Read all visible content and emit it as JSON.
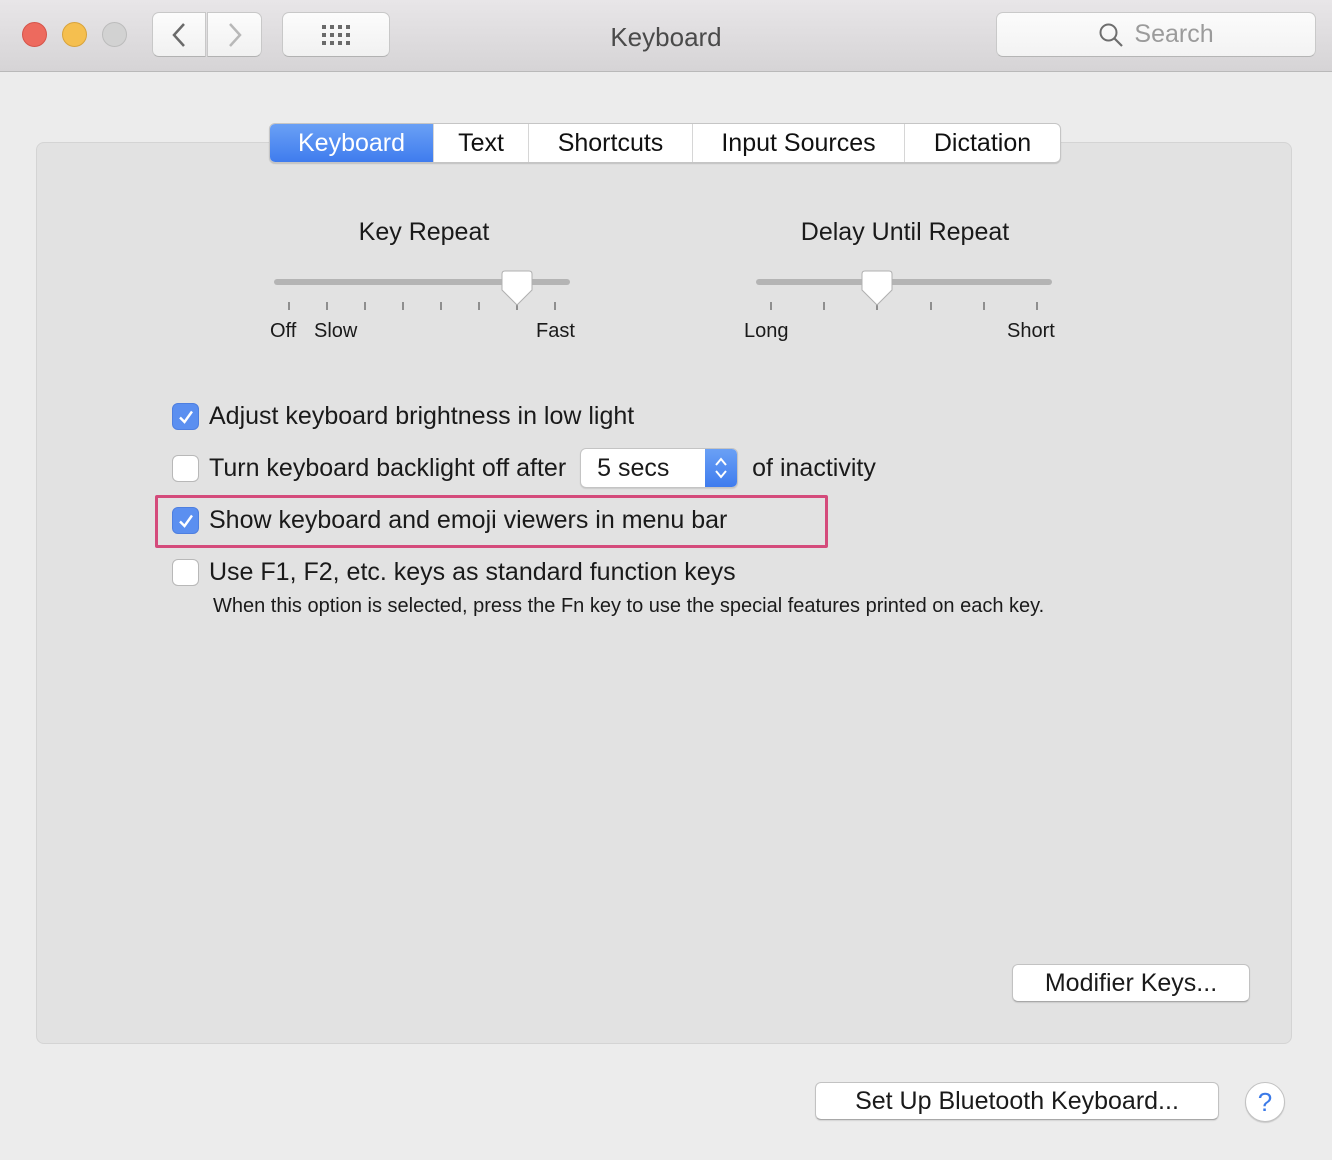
{
  "window": {
    "title": "Keyboard",
    "search_placeholder": "Search"
  },
  "tabs": [
    {
      "label": "Keyboard",
      "active": true
    },
    {
      "label": "Text",
      "active": false
    },
    {
      "label": "Shortcuts",
      "active": false
    },
    {
      "label": "Input Sources",
      "active": false
    },
    {
      "label": "Dictation",
      "active": false
    }
  ],
  "sliders": {
    "key_repeat": {
      "title": "Key Repeat",
      "labels": {
        "off": "Off",
        "slow": "Slow",
        "fast": "Fast"
      },
      "tick_count": 8,
      "selected_tick": 6
    },
    "delay_until_repeat": {
      "title": "Delay Until Repeat",
      "labels": {
        "long": "Long",
        "short": "Short"
      },
      "tick_count": 6,
      "selected_tick": 2
    }
  },
  "options": {
    "adjust_brightness": {
      "label": "Adjust keyboard brightness in low light",
      "checked": true
    },
    "backlight_off": {
      "label": "Turn keyboard backlight off after",
      "checked": false,
      "popup_value": "5 secs",
      "suffix": "of inactivity"
    },
    "show_viewers": {
      "label": "Show keyboard and emoji viewers in menu bar",
      "checked": true
    },
    "function_keys": {
      "label": "Use F1, F2, etc. keys as standard function keys",
      "checked": false,
      "note": "When this option is selected, press the Fn key to use the special features printed on each key."
    }
  },
  "buttons": {
    "modifier_keys": "Modifier Keys...",
    "bluetooth_setup": "Set Up Bluetooth Keyboard...",
    "help": "?"
  },
  "colors": {
    "accent": "#3f7cee",
    "highlight_annotation": "#d44b7b"
  }
}
